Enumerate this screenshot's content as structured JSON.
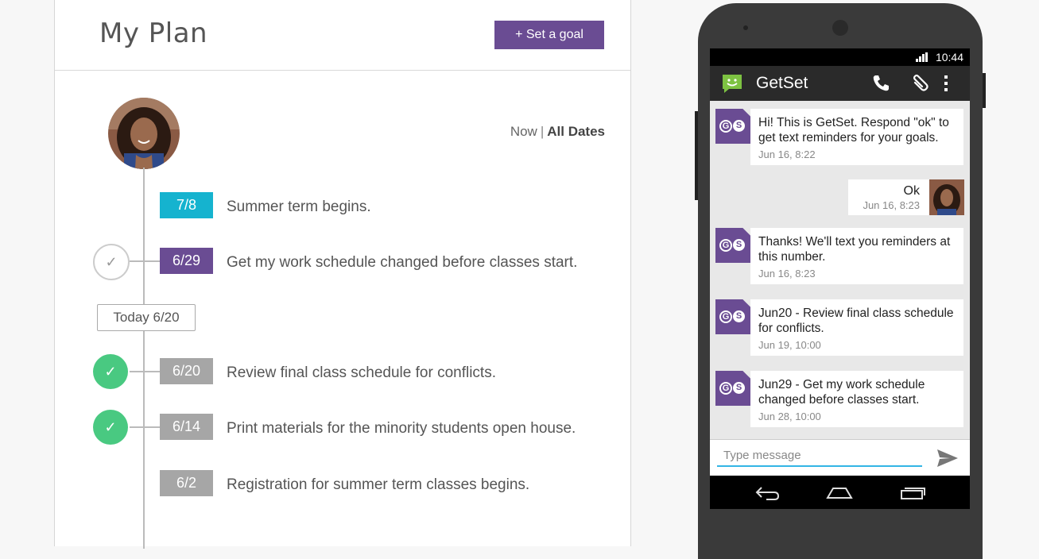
{
  "plan": {
    "title": "My Plan",
    "set_goal_label": "+ Set a goal",
    "filter_now": "Now",
    "filter_sep": "|",
    "filter_all": "All Dates",
    "today_label": "Today 6/20",
    "items": [
      {
        "date": "7/8",
        "text": "Summer term begins.",
        "color": "#15b3cf"
      },
      {
        "date": "6/29",
        "text": "Get my work schedule changed before classes start.",
        "color": "#6a4c93"
      },
      {
        "date": "6/20",
        "text": "Review final class schedule for conflicts.",
        "color": "#a6a6a6"
      },
      {
        "date": "6/14",
        "text": "Print materials for the minority students open house.",
        "color": "#a6a6a6"
      },
      {
        "date": "6/2",
        "text": "Registration for summer term classes begins.",
        "color": "#a6a6a6"
      }
    ],
    "check_glyph": "✓"
  },
  "phone": {
    "status_time": "10:44",
    "app_title": "GetSet",
    "messages": [
      {
        "text": "Hi! This is GetSet. Respond \"ok\" to get text reminders for your goals.",
        "time": "Jun 16, 8:22"
      },
      {
        "text": "Ok",
        "time": "Jun 16, 8:23"
      },
      {
        "text": "Thanks! We'll text you reminders at this number.",
        "time": "Jun 16, 8:23"
      },
      {
        "text": "Jun20 - Review final class schedule for conflicts.",
        "time": "Jun 19, 10:00"
      },
      {
        "text": "Jun29 - Get my work schedule changed before classes start.",
        "time": "Jun 28, 10:00"
      }
    ],
    "input_placeholder": "Type message",
    "badge_g": "G",
    "badge_s": "S"
  },
  "colors": {
    "purple": "#6a4c93",
    "teal": "#15b3cf",
    "green_done": "#49c981",
    "app_green": "#7dc242"
  },
  "icons": [
    "signal-icon",
    "getset-logo-icon",
    "phone-icon",
    "paperclip-icon",
    "overflow-menu-icon",
    "send-icon",
    "back-icon",
    "home-icon",
    "recents-icon",
    "check-icon"
  ]
}
